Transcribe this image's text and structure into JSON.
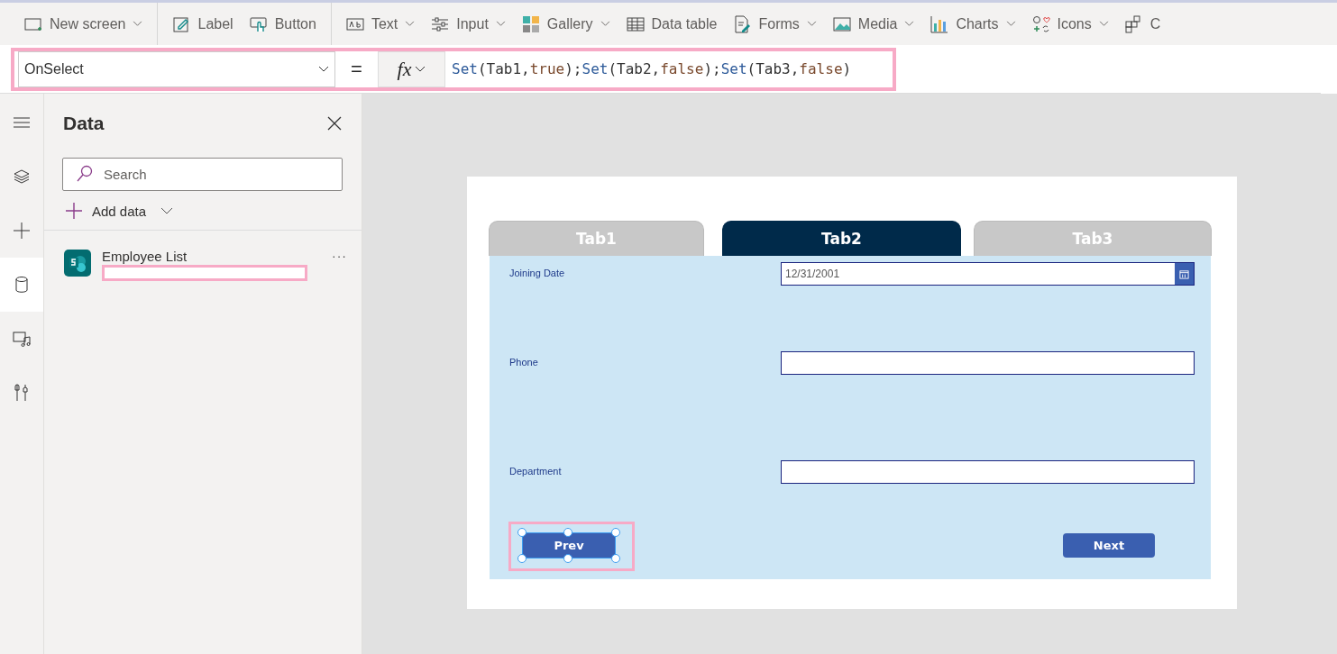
{
  "toolbar": {
    "items": [
      {
        "label": "New screen",
        "dropdown": true,
        "divider_after": true
      },
      {
        "label": "Label",
        "dropdown": false,
        "divider_after": false
      },
      {
        "label": "Button",
        "dropdown": false,
        "divider_after": true
      },
      {
        "label": "Text",
        "dropdown": true,
        "divider_after": false
      },
      {
        "label": "Input",
        "dropdown": true,
        "divider_after": false
      },
      {
        "label": "Gallery",
        "dropdown": true,
        "divider_after": false
      },
      {
        "label": "Data table",
        "dropdown": false,
        "divider_after": false
      },
      {
        "label": "Forms",
        "dropdown": true,
        "divider_after": false
      },
      {
        "label": "Media",
        "dropdown": true,
        "divider_after": false
      },
      {
        "label": "Charts",
        "dropdown": true,
        "divider_after": false
      },
      {
        "label": "Icons",
        "dropdown": true,
        "divider_after": false
      },
      {
        "label": "C",
        "dropdown": false,
        "divider_after": false
      }
    ]
  },
  "formula_bar": {
    "property": "OnSelect",
    "equals": "=",
    "fx": "fx",
    "highlighted": true,
    "formula": [
      {
        "kind": "function",
        "text": "Set"
      },
      {
        "kind": "plain",
        "text": "(Tab1,"
      },
      {
        "kind": "value",
        "text": "true"
      },
      {
        "kind": "plain",
        "text": ");"
      },
      {
        "kind": "function",
        "text": "Set"
      },
      {
        "kind": "plain",
        "text": "(Tab2,"
      },
      {
        "kind": "value",
        "text": "false"
      },
      {
        "kind": "plain",
        "text": ");"
      },
      {
        "kind": "function",
        "text": "Set"
      },
      {
        "kind": "plain",
        "text": "(Tab3,"
      },
      {
        "kind": "value",
        "text": "false"
      },
      {
        "kind": "plain",
        "text": ")"
      }
    ]
  },
  "rail": {
    "items": [
      {
        "selected": false
      },
      {
        "selected": false
      },
      {
        "selected": false
      },
      {
        "selected": true
      },
      {
        "selected": false
      },
      {
        "selected": false
      }
    ]
  },
  "data_panel": {
    "title": "Data",
    "search": {
      "placeholder": "Search"
    },
    "add_data": "Add data",
    "sources": [
      {
        "name": "Employee List",
        "redacted_subtitle": true,
        "more": "···"
      }
    ]
  },
  "app_screen": {
    "tabs": [
      {
        "label": "Tab1",
        "selected": false
      },
      {
        "label": "Tab2",
        "selected": true
      },
      {
        "label": "Tab3",
        "selected": false
      }
    ],
    "fields": [
      {
        "label": "Joining Date",
        "kind": "date",
        "value": "12/31/2001"
      },
      {
        "label": "Phone",
        "kind": "text"
      },
      {
        "label": "Department",
        "kind": "text"
      }
    ],
    "buttons": [
      {
        "label": "Prev",
        "selected": true,
        "highlighted": true
      },
      {
        "label": "Next",
        "selected": false,
        "highlighted": false
      }
    ]
  }
}
